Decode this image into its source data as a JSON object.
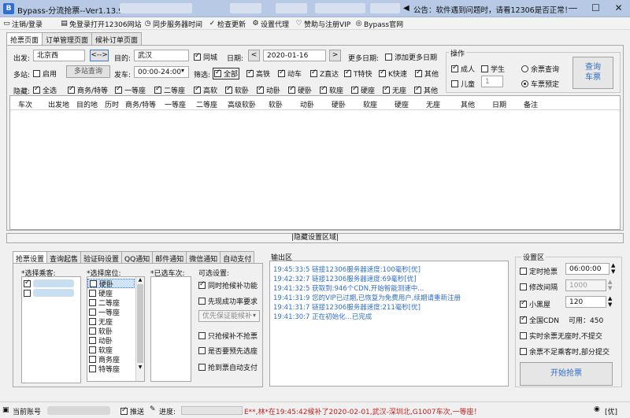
{
  "window": {
    "title": "Bypass-分流抢票--Ver1.13.92",
    "announcement": "公告：软件遇到问题时，请看12306是否正常！",
    "minimize": "—",
    "maximize": "☐",
    "close": "✕"
  },
  "menu": [
    {
      "label": "注销/登录",
      "icon": "monitor-icon"
    },
    {
      "label": "免登录打开12306网站",
      "icon": "page-icon"
    },
    {
      "label": "同步服务器时间",
      "icon": "clock-icon"
    },
    {
      "label": "检查更新",
      "icon": "check-icon"
    },
    {
      "label": "设置代理",
      "icon": "gear-icon"
    },
    {
      "label": "赞助与注册VIP",
      "icon": "heart-icon"
    },
    {
      "label": "Bypass官网",
      "icon": "globe-icon"
    }
  ],
  "tabs": [
    "抢票页面",
    "订单管理页面",
    "候补订单页面"
  ],
  "query": {
    "from_label": "出发:",
    "from_value": "北京西",
    "swap_button": "<-->",
    "to_label": "目的:",
    "to_value": "武汉",
    "same_city_label": "同城",
    "date_label": "日期:",
    "date_prev": "<",
    "date_value": "2020-01-16",
    "date_next": ">",
    "more_dates_label": "更多日期:",
    "add_more_dates_label": "添加更多日期",
    "multi_station_label": "多站:",
    "enable_label": "启用",
    "multi_query_button": "多站查询",
    "depart_label": "发车:",
    "depart_value": "00:00-24:00",
    "filter_label": "筛选:",
    "filter_all": "全部",
    "filters": [
      "高铁",
      "动车",
      "Z直达",
      "T特快",
      "K快速",
      "其他"
    ],
    "hide_label": "隐藏:",
    "hide_all": "全选",
    "hide_items": [
      "商务/特等",
      "一等座",
      "二等座",
      "高软",
      "软卧",
      "动卧",
      "硬卧",
      "软座",
      "硬座",
      "无座",
      "其他"
    ]
  },
  "operate": {
    "title": "操作",
    "adult": "成人",
    "student": "学生",
    "child": "儿童",
    "child_count": "1",
    "remaining_query": "余票查询",
    "booking": "车票预定",
    "query_button": "查询\n车票"
  },
  "grid_columns": [
    "车次",
    "出发地",
    "目的地",
    "历时",
    "商务/特等",
    "一等座",
    "二等座",
    "高级软卧",
    "软卧",
    "动卧",
    "硬卧",
    "软座",
    "硬座",
    "无座",
    "其他",
    "日期",
    "备注"
  ],
  "splitter_label": "|隐藏设置区域|",
  "subtabs": [
    "抢票设置",
    "查询起售",
    "验证码设置",
    "QQ通知",
    "邮件通知",
    "微信通知",
    "自动支付"
  ],
  "ticket_settings": {
    "passengers_label": "*选择乘客:",
    "seats_label": "*选择席位:",
    "seats": [
      {
        "label": "硬卧",
        "checked": false,
        "selected": true
      },
      {
        "label": "硬座",
        "checked": false
      },
      {
        "label": "二等座",
        "checked": false
      },
      {
        "label": "一等座",
        "checked": false
      },
      {
        "label": "无座",
        "checked": false
      },
      {
        "label": "软卧",
        "checked": false
      },
      {
        "label": "动卧",
        "checked": false
      },
      {
        "label": "软座",
        "checked": false
      },
      {
        "label": "商务座",
        "checked": false
      },
      {
        "label": "特等座",
        "checked": false
      }
    ],
    "trains_label": "*已选车次:",
    "options_label": "可选设置:",
    "option_simultaneous": "同时抢候补功能",
    "option_success_rate": "先现成功率要求",
    "priority_select": "优先保证能候补",
    "option_only_waitlist": "只抢候补不抢票",
    "option_choose_seat": "是否要预先选座",
    "option_auto_pay": "抢到票自动支付"
  },
  "output": {
    "title": "输出区",
    "lines": [
      "19:45:33:5  链接12306服务器速度:100毫秒[优]",
      "19:42:32:7  链接12306服务器速度:69毫秒[优]",
      "19:41:32:5  获取到:946个CDN,开始智能测速中...",
      "19:41:31:9  您的VIP已过期,已恢复为免费用户,续期请重新注册",
      "19:41:31:7  链接12306服务器速度:211毫秒[优]",
      "19:41:30:7  正在初始化...已完成"
    ]
  },
  "settings": {
    "title": "设置区",
    "timed_grab": "定时抢票",
    "timed_value": "06:00:00",
    "modify_interval": "修改间隔",
    "interval_value": "1000",
    "blackroom": "小黑屋",
    "blackroom_value": "120",
    "global_cdn": "全国CDN",
    "cdn_available": "可用：450",
    "realtime_no_seat": "实时余票无座时,不提交",
    "insufficient": "余票不足乘客时,部分提交",
    "start_button": "开始抢票"
  },
  "status": {
    "account_label": "当前账号",
    "push_label": "推送",
    "progress_label": "进度:",
    "marquee": "E**,林*在19:45:42候补了2020-02-01,武汉-深圳北,G1007车次,一等座！",
    "quality": "[优]"
  }
}
